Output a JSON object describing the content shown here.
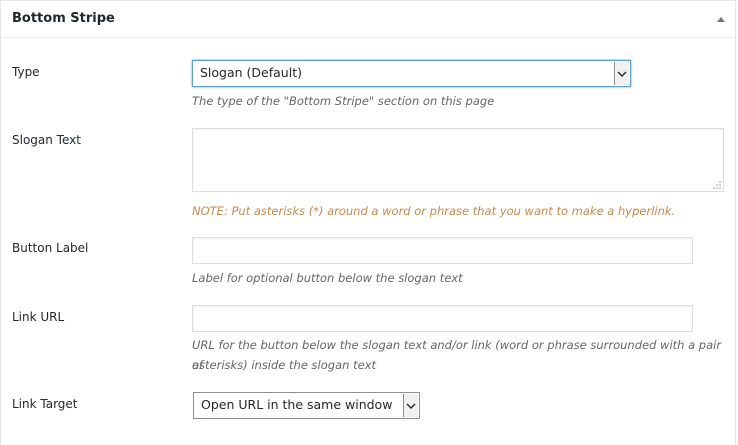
{
  "panel": {
    "title": "Bottom Stripe"
  },
  "icons": {
    "toggle": "triangle-up-icon",
    "select_arrow": "chevron-down-icon",
    "resize": "resize-grip-icon"
  },
  "colors": {
    "accent_focus": "#5b9dd9",
    "note_text": "#c9884b",
    "description_text": "#666666"
  },
  "fields": {
    "type": {
      "label": "Type",
      "selected": "Slogan (Default)",
      "description": "The type of the \"Bottom Stripe\" section on this page"
    },
    "slogan_text": {
      "label": "Slogan Text",
      "value": "",
      "note": "NOTE: Put asterisks (*) around a word or phrase that you want to make a hyperlink."
    },
    "button_label": {
      "label": "Button Label",
      "value": "",
      "description": "Label for optional button below the slogan text"
    },
    "link_url": {
      "label": "Link URL",
      "value": "",
      "description_line1": "URL for the button below the slogan text and/or link (word or phrase surrounded with a pair of",
      "description_line2": "asterisks) inside the slogan text"
    },
    "link_target": {
      "label": "Link Target",
      "selected": "Open URL in the same window"
    }
  }
}
